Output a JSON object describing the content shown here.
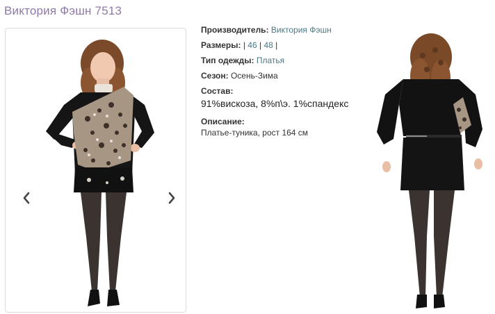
{
  "product": {
    "title": "Виктория Фэшн 7513"
  },
  "details": {
    "manufacturer_label": "Производитель:",
    "manufacturer_value": "Виктория Фэшн",
    "sizes_label": "Размеры:",
    "sizes_sep": "|",
    "sizes": [
      "46",
      "48"
    ],
    "type_label": "Тип одежды:",
    "type_value": "Платья",
    "season_label": "Сезон:",
    "season_value": "Осень-Зима",
    "composition_label": "Состав:",
    "composition_value": "91%вискоза, 8%п\\э. 1%спандекс",
    "description_label": "Описание:",
    "description_value": "Платье-туника, рост 164 см"
  },
  "gallery": {
    "prev_icon": "chevron-left-icon",
    "next_icon": "chevron-right-icon"
  },
  "colors": {
    "title": "#8e7aa8",
    "link": "#4a7a87",
    "border": "#d9d9d9"
  }
}
